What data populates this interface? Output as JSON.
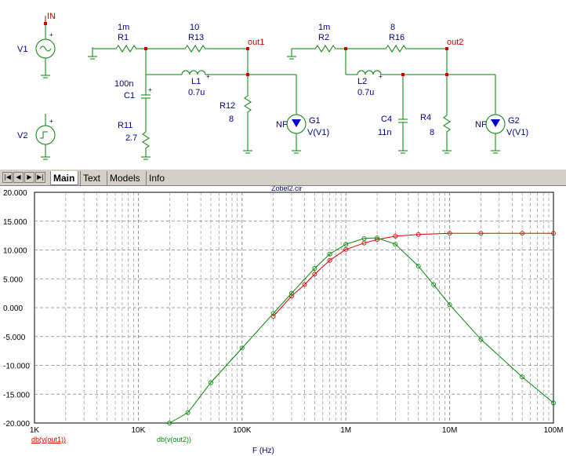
{
  "schematic": {
    "ports": {
      "in": "IN",
      "out1": "out1",
      "out2": "out2"
    },
    "sources": [
      {
        "name": "V1"
      },
      {
        "name": "V2"
      }
    ],
    "components": [
      {
        "name": "R1",
        "value": "1m"
      },
      {
        "name": "R13",
        "value": "10"
      },
      {
        "name": "C1",
        "value": "100n"
      },
      {
        "name": "L1",
        "value": "0.7u"
      },
      {
        "name": "R11",
        "value": "2.7"
      },
      {
        "name": "R12",
        "value": "8"
      },
      {
        "name": "G1",
        "value": "V(V1)",
        "tag": "NF"
      },
      {
        "name": "R2",
        "value": "1m"
      },
      {
        "name": "R16",
        "value": "8"
      },
      {
        "name": "L2",
        "value": "0.7u"
      },
      {
        "name": "C4",
        "value": "11n"
      },
      {
        "name": "R4",
        "value": "8"
      },
      {
        "name": "G2",
        "value": "V(V1)",
        "tag": "NF"
      }
    ]
  },
  "tabs": [
    {
      "label": "Main",
      "active": true
    },
    {
      "label": "Text",
      "active": false
    },
    {
      "label": "Models",
      "active": false
    },
    {
      "label": "Info",
      "active": false
    }
  ],
  "plot_title_partial": "Zobel2.cir",
  "chart_data": {
    "type": "line",
    "x_scale": "log",
    "xlabel": "F (Hz)",
    "x_tick_labels": [
      "1K",
      "10K",
      "100K",
      "1M",
      "10M",
      "100M"
    ],
    "y_tick_labels": [
      "20.000",
      "15.000",
      "10.000",
      "5.000",
      "0.000",
      "-5.000",
      "-10.000",
      "-15.000",
      "-20.000"
    ],
    "xlim": [
      1000,
      100000000
    ],
    "ylim": [
      -20,
      20
    ],
    "grid": true,
    "series": [
      {
        "name": "db(v(out1))",
        "color": "#dd0000",
        "x": [
          200000,
          300000,
          400000,
          500000,
          700000,
          1000000,
          1500000,
          2000000,
          3000000,
          5000000,
          10000000,
          20000000,
          50000000,
          100000000
        ],
        "values": [
          -1.5,
          2.0,
          4.0,
          5.8,
          8.2,
          10.1,
          11.2,
          11.8,
          12.4,
          12.7,
          12.9,
          12.9,
          12.9,
          12.9
        ]
      },
      {
        "name": "db(v(out2))",
        "color": "#008800",
        "x": [
          20000,
          30000,
          50000,
          100000,
          200000,
          300000,
          500000,
          700000,
          1000000,
          1500000,
          2000000,
          3000000,
          5000000,
          7000000,
          10000000,
          20000000,
          50000000,
          100000000
        ],
        "values": [
          -20.0,
          -18.2,
          -13.0,
          -7.0,
          -1.0,
          2.5,
          6.8,
          9.3,
          11.0,
          12.0,
          12.1,
          11.0,
          7.2,
          4.0,
          0.5,
          -5.5,
          -12.0,
          -16.5
        ]
      }
    ]
  }
}
